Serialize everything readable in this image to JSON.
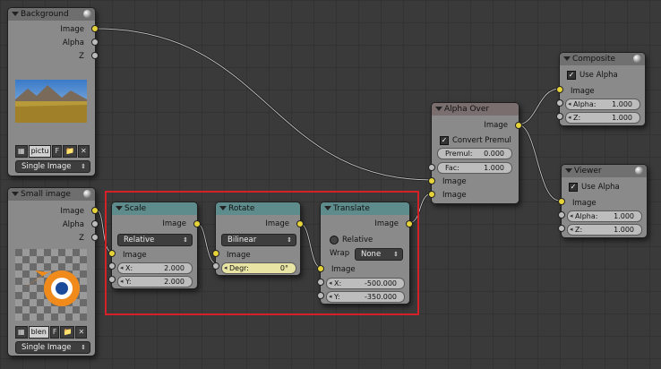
{
  "colors": {
    "canvas": "#3a3a3a",
    "node_body": "#8a8a8a",
    "selection": "#d42028",
    "socket_image": "#e6d33a",
    "socket_value": "#bcbcbc"
  },
  "nodes": {
    "background": {
      "title": "Background",
      "outputs": [
        "Image",
        "Alpha",
        "Z"
      ],
      "image_name": "pictu",
      "fake_user": "F",
      "source": "Single Image"
    },
    "small_image": {
      "title": "Small image",
      "outputs": [
        "Image",
        "Alpha",
        "Z"
      ],
      "image_name": "blen",
      "fake_user": "F",
      "source": "Single Image"
    },
    "scale": {
      "title": "Scale",
      "output": "Image",
      "space": "Relative",
      "input_image": "Image",
      "x_label": "X:",
      "x_value": "2.000",
      "y_label": "Y:",
      "y_value": "2.000"
    },
    "rotate": {
      "title": "Rotate",
      "output": "Image",
      "filter": "Bilinear",
      "input_image": "Image",
      "deg_label": "Degr:",
      "deg_value": "0°"
    },
    "translate": {
      "title": "Translate",
      "output": "Image",
      "relative_label": "Relative",
      "wrap_label": "Wrap",
      "wrap_value": "None",
      "input_image": "Image",
      "x_label": "X:",
      "x_value": "-500.000",
      "y_label": "Y:",
      "y_value": "-350.000"
    },
    "alpha_over": {
      "title": "Alpha Over",
      "output": "Image",
      "convert_premul": "Convert Premul",
      "premul_label": "Premul:",
      "premul_value": "0.000",
      "fac_label": "Fac:",
      "fac_value": "1.000",
      "input1": "Image",
      "input2": "Image"
    },
    "composite": {
      "title": "Composite",
      "use_alpha": "Use Alpha",
      "input_image": "Image",
      "alpha_label": "Alpha:",
      "alpha_value": "1.000",
      "z_label": "Z:",
      "z_value": "1.000"
    },
    "viewer": {
      "title": "Viewer",
      "use_alpha": "Use Alpha",
      "input_image": "Image",
      "alpha_label": "Alpha:",
      "alpha_value": "1.000",
      "z_label": "Z:",
      "z_value": "1.000"
    }
  }
}
